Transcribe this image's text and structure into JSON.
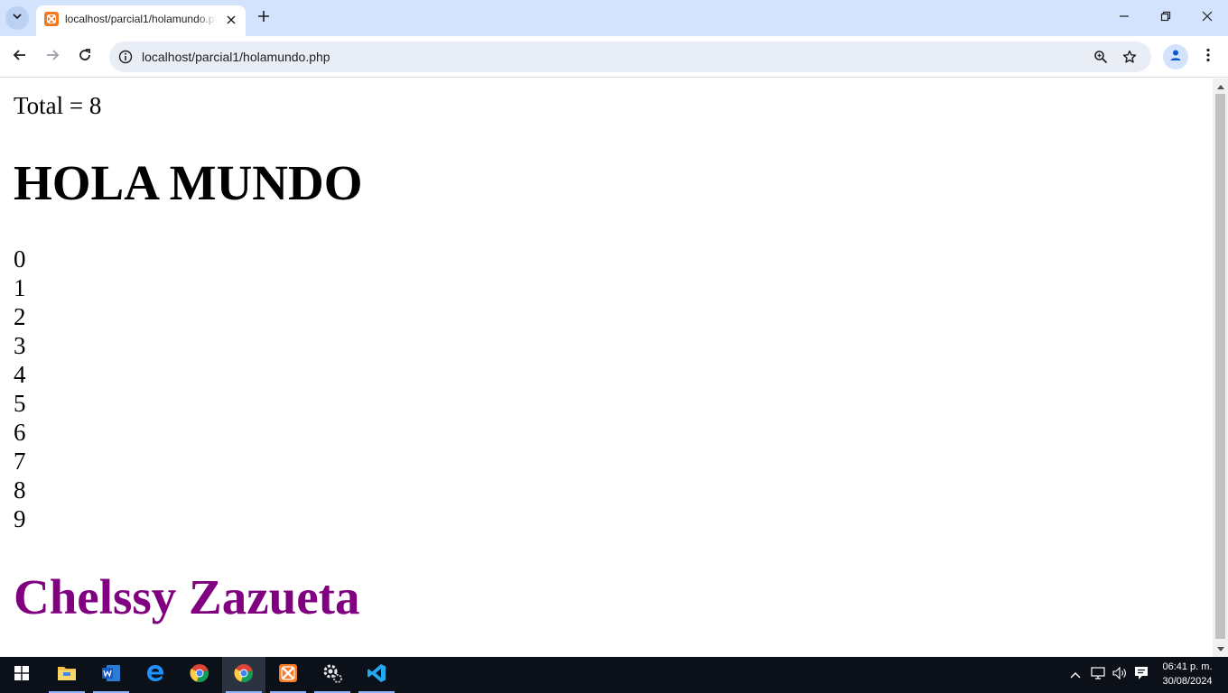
{
  "browser": {
    "tab_title": "localhost/parcial1/holamundo.php",
    "url": "localhost/parcial1/holamundo.php",
    "accent_color": "#d3e3fd"
  },
  "page": {
    "total_text": "Total = 8",
    "heading": "HOLA MUNDO",
    "numbers": [
      "0",
      "1",
      "2",
      "3",
      "4",
      "5",
      "6",
      "7",
      "8",
      "9"
    ],
    "author": "Chelssy Zazueta",
    "author_color": "#800080"
  },
  "taskbar": {
    "apps": [
      "start-icon",
      "file-explorer-icon",
      "word-icon",
      "edge-icon",
      "chrome-icon",
      "chrome-icon",
      "xampp-icon",
      "settings-gear-icon",
      "vscode-icon"
    ],
    "time": "06:41 p. m.",
    "date": "30/08/2024"
  }
}
